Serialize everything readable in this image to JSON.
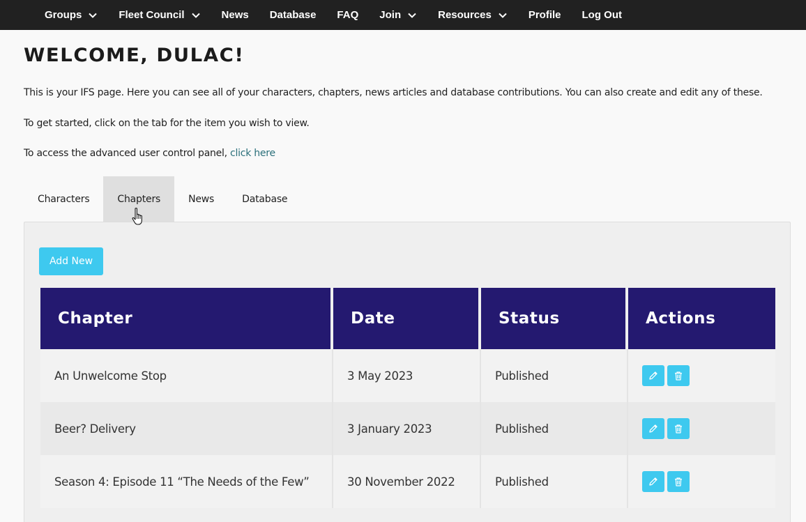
{
  "nav": {
    "items": [
      {
        "label": "Groups",
        "dropdown": true
      },
      {
        "label": "Fleet Council",
        "dropdown": true
      },
      {
        "label": "News",
        "dropdown": false
      },
      {
        "label": "Database",
        "dropdown": false
      },
      {
        "label": "FAQ",
        "dropdown": false
      },
      {
        "label": "Join",
        "dropdown": true
      },
      {
        "label": "Resources",
        "dropdown": true
      },
      {
        "label": "Profile",
        "dropdown": false
      },
      {
        "label": "Log Out",
        "dropdown": false
      }
    ]
  },
  "page": {
    "title": "WELCOME, DULAC!",
    "intro1": "This is your IFS page. Here you can see all of your characters, chapters, news articles and database contributions. You can also create and edit any of these.",
    "intro2": "To get started, click on the tab for the item you wish to view.",
    "intro3_prefix": "To access the advanced user control panel, ",
    "intro3_link": "click here"
  },
  "tabs": [
    {
      "label": "Characters",
      "active": false
    },
    {
      "label": "Chapters",
      "active": true
    },
    {
      "label": "News",
      "active": false
    },
    {
      "label": "Database",
      "active": false
    }
  ],
  "panel": {
    "add_label": "Add New"
  },
  "table": {
    "headers": [
      "Chapter",
      "Date",
      "Status",
      "Actions"
    ],
    "rows": [
      {
        "chapter": "An Unwelcome Stop",
        "date": "3 May 2023",
        "status": "Published"
      },
      {
        "chapter": "Beer? Delivery",
        "date": "3 January 2023",
        "status": "Published"
      },
      {
        "chapter": "Season 4: Episode 11 “The Needs of the Few”",
        "date": "30 November 2022",
        "status": "Published"
      }
    ]
  },
  "icons": {
    "dropdown": "chevron-down-icon",
    "edit": "pencil-icon",
    "delete": "trash-icon",
    "cursor": "hand-pointer-icon"
  },
  "colors": {
    "nav_bg": "#212121",
    "header_bg": "#241970",
    "accent": "#3ec9ef",
    "link": "#2a6f7a",
    "tab_active_bg": "#dfdfdf"
  }
}
